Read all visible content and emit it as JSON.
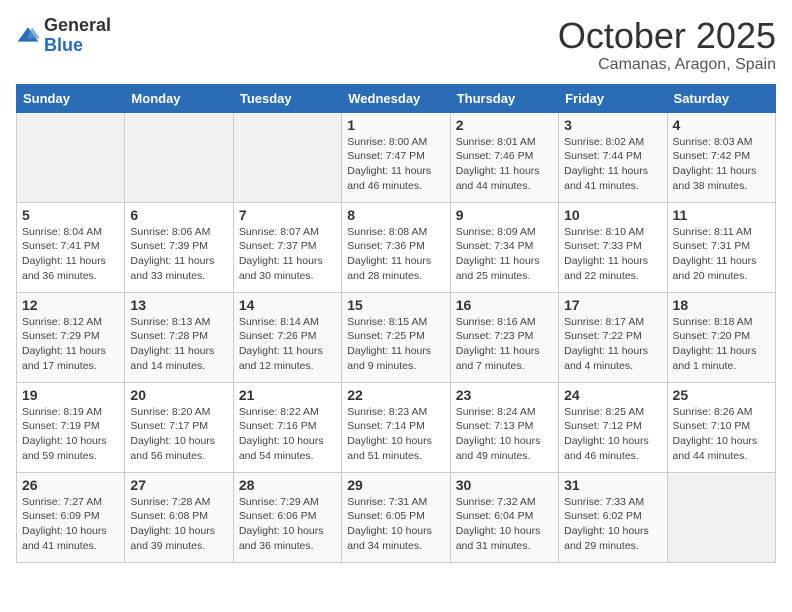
{
  "logo": {
    "general": "General",
    "blue": "Blue"
  },
  "calendar": {
    "title": "October 2025",
    "subtitle": "Camanas, Aragon, Spain"
  },
  "weekdays": [
    "Sunday",
    "Monday",
    "Tuesday",
    "Wednesday",
    "Thursday",
    "Friday",
    "Saturday"
  ],
  "weeks": [
    [
      {
        "day": null,
        "sunrise": null,
        "sunset": null,
        "daylight": null
      },
      {
        "day": null,
        "sunrise": null,
        "sunset": null,
        "daylight": null
      },
      {
        "day": null,
        "sunrise": null,
        "sunset": null,
        "daylight": null
      },
      {
        "day": "1",
        "sunrise": "8:00 AM",
        "sunset": "7:47 PM",
        "daylight": "11 hours and 46 minutes."
      },
      {
        "day": "2",
        "sunrise": "8:01 AM",
        "sunset": "7:46 PM",
        "daylight": "11 hours and 44 minutes."
      },
      {
        "day": "3",
        "sunrise": "8:02 AM",
        "sunset": "7:44 PM",
        "daylight": "11 hours and 41 minutes."
      },
      {
        "day": "4",
        "sunrise": "8:03 AM",
        "sunset": "7:42 PM",
        "daylight": "11 hours and 38 minutes."
      }
    ],
    [
      {
        "day": "5",
        "sunrise": "8:04 AM",
        "sunset": "7:41 PM",
        "daylight": "11 hours and 36 minutes."
      },
      {
        "day": "6",
        "sunrise": "8:06 AM",
        "sunset": "7:39 PM",
        "daylight": "11 hours and 33 minutes."
      },
      {
        "day": "7",
        "sunrise": "8:07 AM",
        "sunset": "7:37 PM",
        "daylight": "11 hours and 30 minutes."
      },
      {
        "day": "8",
        "sunrise": "8:08 AM",
        "sunset": "7:36 PM",
        "daylight": "11 hours and 28 minutes."
      },
      {
        "day": "9",
        "sunrise": "8:09 AM",
        "sunset": "7:34 PM",
        "daylight": "11 hours and 25 minutes."
      },
      {
        "day": "10",
        "sunrise": "8:10 AM",
        "sunset": "7:33 PM",
        "daylight": "11 hours and 22 minutes."
      },
      {
        "day": "11",
        "sunrise": "8:11 AM",
        "sunset": "7:31 PM",
        "daylight": "11 hours and 20 minutes."
      }
    ],
    [
      {
        "day": "12",
        "sunrise": "8:12 AM",
        "sunset": "7:29 PM",
        "daylight": "11 hours and 17 minutes."
      },
      {
        "day": "13",
        "sunrise": "8:13 AM",
        "sunset": "7:28 PM",
        "daylight": "11 hours and 14 minutes."
      },
      {
        "day": "14",
        "sunrise": "8:14 AM",
        "sunset": "7:26 PM",
        "daylight": "11 hours and 12 minutes."
      },
      {
        "day": "15",
        "sunrise": "8:15 AM",
        "sunset": "7:25 PM",
        "daylight": "11 hours and 9 minutes."
      },
      {
        "day": "16",
        "sunrise": "8:16 AM",
        "sunset": "7:23 PM",
        "daylight": "11 hours and 7 minutes."
      },
      {
        "day": "17",
        "sunrise": "8:17 AM",
        "sunset": "7:22 PM",
        "daylight": "11 hours and 4 minutes."
      },
      {
        "day": "18",
        "sunrise": "8:18 AM",
        "sunset": "7:20 PM",
        "daylight": "11 hours and 1 minute."
      }
    ],
    [
      {
        "day": "19",
        "sunrise": "8:19 AM",
        "sunset": "7:19 PM",
        "daylight": "10 hours and 59 minutes."
      },
      {
        "day": "20",
        "sunrise": "8:20 AM",
        "sunset": "7:17 PM",
        "daylight": "10 hours and 56 minutes."
      },
      {
        "day": "21",
        "sunrise": "8:22 AM",
        "sunset": "7:16 PM",
        "daylight": "10 hours and 54 minutes."
      },
      {
        "day": "22",
        "sunrise": "8:23 AM",
        "sunset": "7:14 PM",
        "daylight": "10 hours and 51 minutes."
      },
      {
        "day": "23",
        "sunrise": "8:24 AM",
        "sunset": "7:13 PM",
        "daylight": "10 hours and 49 minutes."
      },
      {
        "day": "24",
        "sunrise": "8:25 AM",
        "sunset": "7:12 PM",
        "daylight": "10 hours and 46 minutes."
      },
      {
        "day": "25",
        "sunrise": "8:26 AM",
        "sunset": "7:10 PM",
        "daylight": "10 hours and 44 minutes."
      }
    ],
    [
      {
        "day": "26",
        "sunrise": "7:27 AM",
        "sunset": "6:09 PM",
        "daylight": "10 hours and 41 minutes."
      },
      {
        "day": "27",
        "sunrise": "7:28 AM",
        "sunset": "6:08 PM",
        "daylight": "10 hours and 39 minutes."
      },
      {
        "day": "28",
        "sunrise": "7:29 AM",
        "sunset": "6:06 PM",
        "daylight": "10 hours and 36 minutes."
      },
      {
        "day": "29",
        "sunrise": "7:31 AM",
        "sunset": "6:05 PM",
        "daylight": "10 hours and 34 minutes."
      },
      {
        "day": "30",
        "sunrise": "7:32 AM",
        "sunset": "6:04 PM",
        "daylight": "10 hours and 31 minutes."
      },
      {
        "day": "31",
        "sunrise": "7:33 AM",
        "sunset": "6:02 PM",
        "daylight": "10 hours and 29 minutes."
      },
      {
        "day": null,
        "sunrise": null,
        "sunset": null,
        "daylight": null
      }
    ]
  ]
}
